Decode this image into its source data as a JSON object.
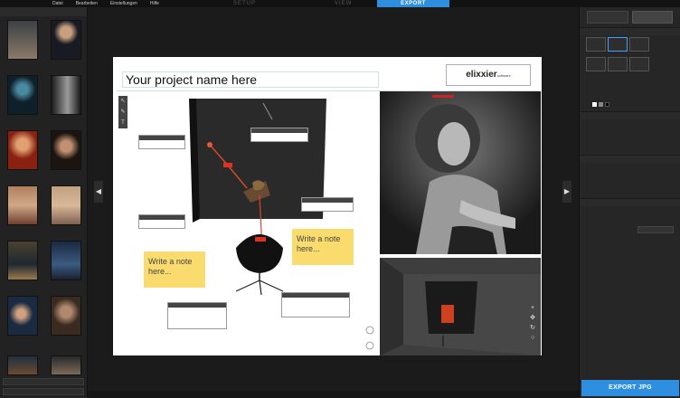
{
  "topbar": {
    "menus": [
      "Datei",
      "Bearbeiten",
      "Einstellungen",
      "Hilfe"
    ],
    "modes": [
      "SETUP",
      "VIEW"
    ],
    "export_tab": "EXPORT"
  },
  "filmstrip": {
    "bottom_buttons": [
      "",
      ""
    ]
  },
  "sheet": {
    "title": "Your project name here",
    "brand": "elixxier",
    "brand_sub": "software"
  },
  "notes": [
    {
      "text": "Write a note here..."
    },
    {
      "text": "Write a note here..."
    }
  ],
  "rightpanel": {
    "export_button": "EXPORT JPG"
  },
  "colors": {
    "accent": "#2e8ee0",
    "note": "#fadb6e"
  }
}
